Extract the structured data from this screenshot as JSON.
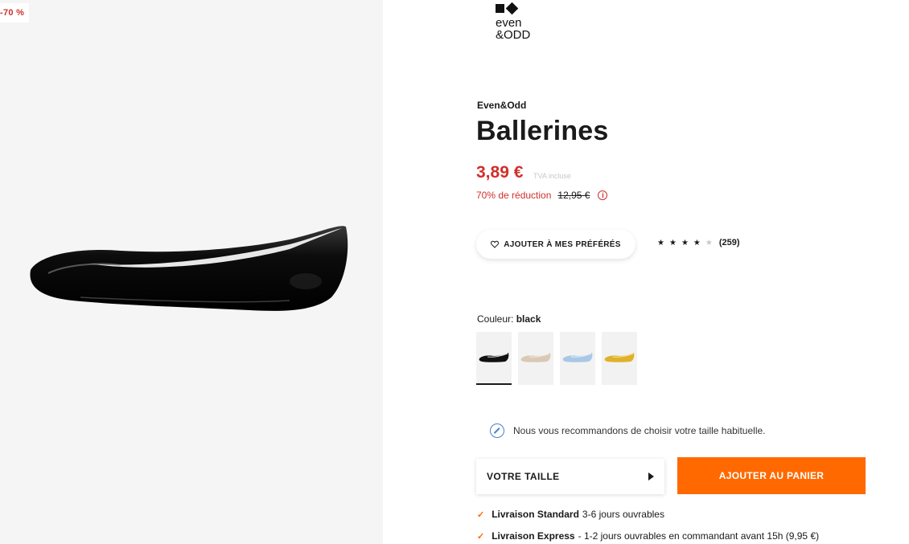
{
  "gallery": {
    "discount_flag": "-70 %",
    "image_icon": "black-patent-ballerina-image"
  },
  "logo": {
    "line1": "even",
    "line2": "&ODD"
  },
  "product": {
    "brand": "Even&Odd",
    "title": "Ballerines",
    "price": "3,89 €",
    "vat_note": "TVA incluse",
    "reduction_text": "70% de réduction",
    "old_price": "12,95 €",
    "info_icon": "i"
  },
  "favorite_button": {
    "label": "AJOUTER À MES PRÉFÉRÉS",
    "icon": "heart-icon"
  },
  "rating": {
    "stars": [
      true,
      true,
      true,
      true,
      false
    ],
    "star_glyph": "★",
    "count": "(259)"
  },
  "color": {
    "label": "Couleur:",
    "selected": "black",
    "swatches": [
      {
        "name": "black",
        "color": "#111111",
        "selected": true
      },
      {
        "name": "beige",
        "color": "#d9c9b5",
        "selected": false
      },
      {
        "name": "light-blue",
        "color": "#a9c8e6",
        "selected": false
      },
      {
        "name": "yellow",
        "color": "#e0b22a",
        "selected": false
      }
    ]
  },
  "advice": {
    "text": "Nous vous recommandons de choisir votre taille habituelle."
  },
  "size_select": {
    "label": "VOTRE TAILLE"
  },
  "cart": {
    "label": "AJOUTER AU PANIER",
    "color": "#ff6900"
  },
  "delivery": [
    {
      "title": "Livraison Standard",
      "detail": "3-6 jours ouvrables",
      "check": "✓"
    },
    {
      "title": "Livraison Express",
      "detail": "- 1-2 jours ouvrables en commandant avant 15h (9,95 €)",
      "check": "✓"
    }
  ]
}
